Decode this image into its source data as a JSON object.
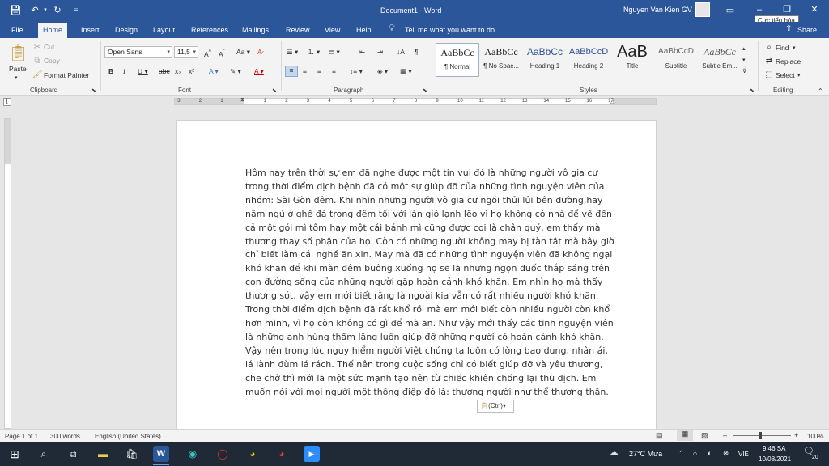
{
  "titlebar": {
    "doc_title": "Document1  -  Word",
    "user": "Nguyen Van Kien GV",
    "tooltip": "Cực tiểu hóa"
  },
  "tabs": [
    "File",
    "Home",
    "Insert",
    "Design",
    "Layout",
    "References",
    "Mailings",
    "Review",
    "View",
    "Help"
  ],
  "tell_me": "Tell me what you want to do",
  "share": "Share",
  "clipboard": {
    "paste": "Paste",
    "cut": "Cut",
    "copy": "Copy",
    "format_painter": "Format Painter",
    "label": "Clipboard"
  },
  "font": {
    "name": "Open Sans",
    "size": "11,5",
    "label": "Font"
  },
  "paragraph": {
    "label": "Paragraph"
  },
  "styles": {
    "items": [
      {
        "preview": "AaBbCc",
        "name": "¶ Normal"
      },
      {
        "preview": "AaBbCc",
        "name": "¶ No Spac..."
      },
      {
        "preview": "AaBbCc",
        "name": "Heading 1"
      },
      {
        "preview": "AaBbCcD",
        "name": "Heading 2"
      },
      {
        "preview": "AaB",
        "name": "Title"
      },
      {
        "preview": "AaBbCcD",
        "name": "Subtitle"
      },
      {
        "preview": "AaBbCc",
        "name": "Subtle Em..."
      }
    ],
    "label": "Styles"
  },
  "editing": {
    "find": "Find",
    "replace": "Replace",
    "select": "Select",
    "label": "Editing"
  },
  "ruler_numbers": [
    "3",
    "2",
    "1",
    "1",
    "2",
    "3",
    "4",
    "5",
    "6",
    "7",
    "8",
    "9",
    "10",
    "11",
    "12",
    "13",
    "14",
    "15",
    "16",
    "17"
  ],
  "document": {
    "text": "Hôm nay trên thời sự em đã nghe được một tin vui đó là những người vô gia cư trong thời điểm dịch bệnh đã có một sự giúp đỡ của những tình nguyện viên của nhóm: Sài Gòn đêm. Khi nhìn những người vô gia cư ngồi thủi lủi bên đường,hay nằm ngủ ở ghế đá trong đêm tối với làn gió lạnh lẽo vì họ không có nhà để về đến cả một gói mì tôm hay một cái bánh mì cũng được coi là chân quý, em thấy mà thương thay số phận của họ. Còn có những người không may bị tàn tật mà bây giờ chỉ biết làm cái nghề ăn xin. May mà đã có những tình nguyện viên đã không ngại khó khăn để khi màn đêm buông xuống họ sẽ là những ngọn đuốc thắp sáng trên con đường sống của những người gặp hoàn cảnh khó khăn. Em nhìn họ mà thấy thương sót, vậy em mới biết rằng là ngoài kia vẫn có rất nhiều người khó khăn. Trong thời điểm dịch bệnh đã rất khổ rồi mà em mới biết còn nhiều người còn khổ hơn mình, vì họ còn không có gì để mà ăn. Như vậy mới thấy các tình nguyện viên là những anh hùng thầm lặng luôn giúp đỡ những người có hoàn cảnh khó khăn. Vậy nên trong lúc nguy hiểm người Việt chúng ta luôn có lòng bao dung, nhân ái, lá lành đùm lá rách. Thế nên trong cuộc sống chỉ có biết giúp đỡ và yêu thương, che chở thì mới là một sức mạnh tạo nên từ chiếc khiên chống lại thù địch. Em muốn nói với mọi người một thông điệp đó là: thương người như thể thương thân.",
    "paste_options": "(Ctrl)"
  },
  "status": {
    "page": "Page 1 of 1",
    "words": "300 words",
    "lang": "English (United States)",
    "zoom": "100%"
  },
  "taskbar": {
    "weather": "27°C  Mưa",
    "lang": "VIE",
    "time": "9:46 SA",
    "date": "10/08/2021",
    "notif": "20"
  }
}
